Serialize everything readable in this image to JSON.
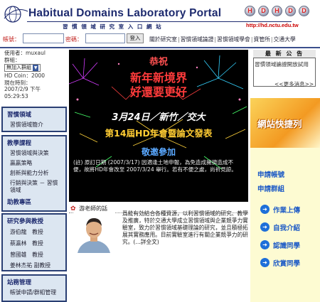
{
  "header": {
    "title": "Habitual Domains Laboratory Portal",
    "subtitle": "習 慣 領 域 研 究 室 入 口 網 站",
    "url": "http://hd.nctu.edu.tw",
    "logo_letters": [
      "H",
      "D",
      "H",
      "D",
      "D"
    ]
  },
  "login": {
    "account_label": "帳號：",
    "password_label": "密碼：",
    "submit_label": "登入"
  },
  "topnav": [
    "關於研究室",
    "習慣領域論證",
    "習慣領域學會",
    "資管所",
    "交通大學"
  ],
  "user": {
    "user_label": "使用者：",
    "user_name": "muxaul",
    "group_label": "群組：",
    "group_value": "無加入群組",
    "coin_label": "HD Coin：",
    "coin_value": "2000",
    "time_label": "現在時刻：",
    "time_value_1": "2007/2/9 下午",
    "time_value_2": "05:29:53"
  },
  "left_panels": [
    {
      "head": "習慣領域",
      "items": [
        "習慣領域簡介"
      ]
    },
    {
      "head": "教學課程",
      "items": [
        "習慣領域與決策",
        "贏贏策略",
        "創新與能力分析",
        "行銷與決策 － 習慣領域"
      ],
      "foot": "助教專區"
    },
    {
      "head": "研究參與教授",
      "items": [
        "游伯龍　教授",
        "蔡瀛林　教授",
        "曾國雄　教授",
        "姜林杰祐 副教授"
      ]
    },
    {
      "head": "站務管理",
      "items": [
        "帳號申請/群組管理"
      ]
    }
  ],
  "banner": {
    "line1": "恭祝",
    "line2": "新年新境界",
    "line3": "好還要更好",
    "line4": "3月24日／新竹／交大",
    "line5": "第14屆HD年會暨論文發表",
    "line6": "敬邀參加",
    "note": "(註) 原訂日期 (2007/3/17) 因適逢土地申報，為免造成擁擠造成不便，故將HD年會改至 2007/3/24 舉行。若有不便之處，尚祈見諒。"
  },
  "teacher": {
    "section_title": "游老師的話",
    "text": "爲能有効結合各種資源，以利習慣領域的研究、教學及推廣，特於交通大學成立習慣領域與企業競爭力實驗室，致力於習慣領域基礎理論的研究，並且積極拓展其實務應用。目前實驗室進行有關企業競爭力的研究。(...詳全文)"
  },
  "announce": {
    "title": "最 新 公 告",
    "item": "習慣領域論證開放試用",
    "more": "<<更多消息>>"
  },
  "shortcuts": {
    "title": "網站快捷列",
    "links": [
      "申請帳號",
      "申請群組"
    ],
    "buttons": [
      "作業上傳",
      "自我介紹",
      "認識同學",
      "欣賞同學"
    ]
  },
  "colors": {
    "navy": "#1d2a6e",
    "panel_bg": "#dce6f1",
    "accent_red": "#c2231f",
    "shortcut_bg": "#fdfbd2"
  }
}
